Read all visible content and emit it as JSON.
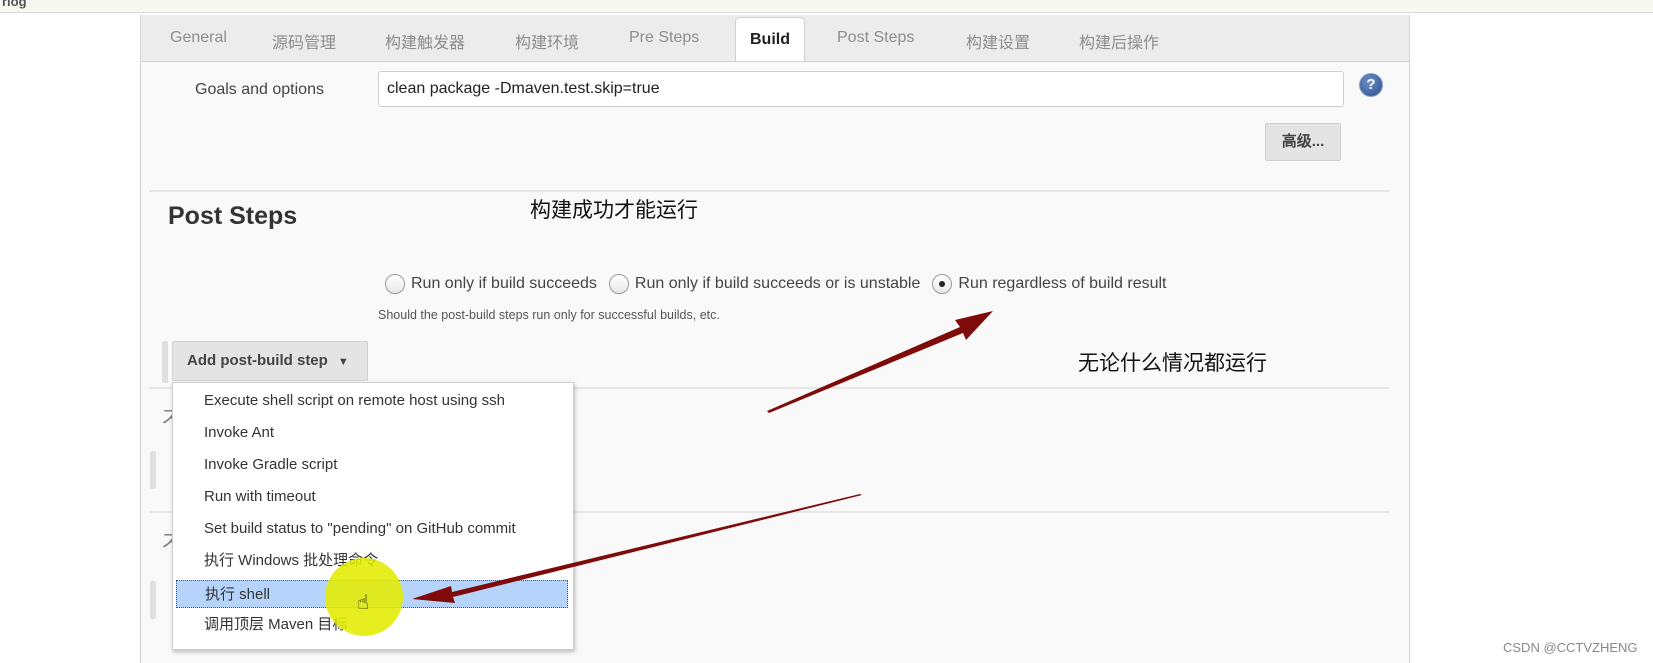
{
  "top_strip": {
    "crumb": "rlog"
  },
  "tabs": [
    {
      "label": "General",
      "active": false
    },
    {
      "label": "源码管理",
      "active": false
    },
    {
      "label": "构建触发器",
      "active": false
    },
    {
      "label": "构建环境",
      "active": false
    },
    {
      "label": "Pre Steps",
      "active": false
    },
    {
      "label": "Build",
      "active": true
    },
    {
      "label": "Post Steps",
      "active": false
    },
    {
      "label": "构建设置",
      "active": false
    },
    {
      "label": "构建后操作",
      "active": false
    }
  ],
  "build": {
    "goals_label": "Goals and options",
    "goals_value": "clean package -Dmaven.test.skip=true",
    "help_icon": "question-circle-icon",
    "help_glyph": "?",
    "advanced_button": "高级..."
  },
  "post_steps": {
    "title": "Post Steps",
    "radio_options": [
      {
        "label": "Run only if build succeeds",
        "checked": false
      },
      {
        "label": "Run only if build succeeds or is unstable",
        "checked": false
      },
      {
        "label": "Run regardless of build result",
        "checked": true
      }
    ],
    "hint": "Should the post-build steps run only for successful builds, etc.",
    "add_button": "Add post-build step",
    "add_button_caret": "▼"
  },
  "dropdown_menu": {
    "items": [
      {
        "label": "Execute shell script on remote host using ssh",
        "highlighted": false
      },
      {
        "label": "Invoke Ant",
        "highlighted": false
      },
      {
        "label": "Invoke Gradle script",
        "highlighted": false
      },
      {
        "label": "Run with timeout",
        "highlighted": false
      },
      {
        "label": "Set build status to \"pending\" on GitHub commit",
        "highlighted": false
      },
      {
        "label": "执行 Windows 批处理命令",
        "highlighted": false
      },
      {
        "label": "执行 shell",
        "highlighted": true
      },
      {
        "label": "调用顶层 Maven 目标",
        "highlighted": false
      }
    ]
  },
  "annotations": {
    "success_only": "构建成功才能运行",
    "always_run": "无论什么情况都运行",
    "arrow_color": "#7f0a0a",
    "halo_color": "#e4ec00"
  },
  "cursor": {
    "icon": "hand-pointer-icon",
    "glyph": "☝"
  },
  "watermark": "CSDN @CCTVZHENG"
}
